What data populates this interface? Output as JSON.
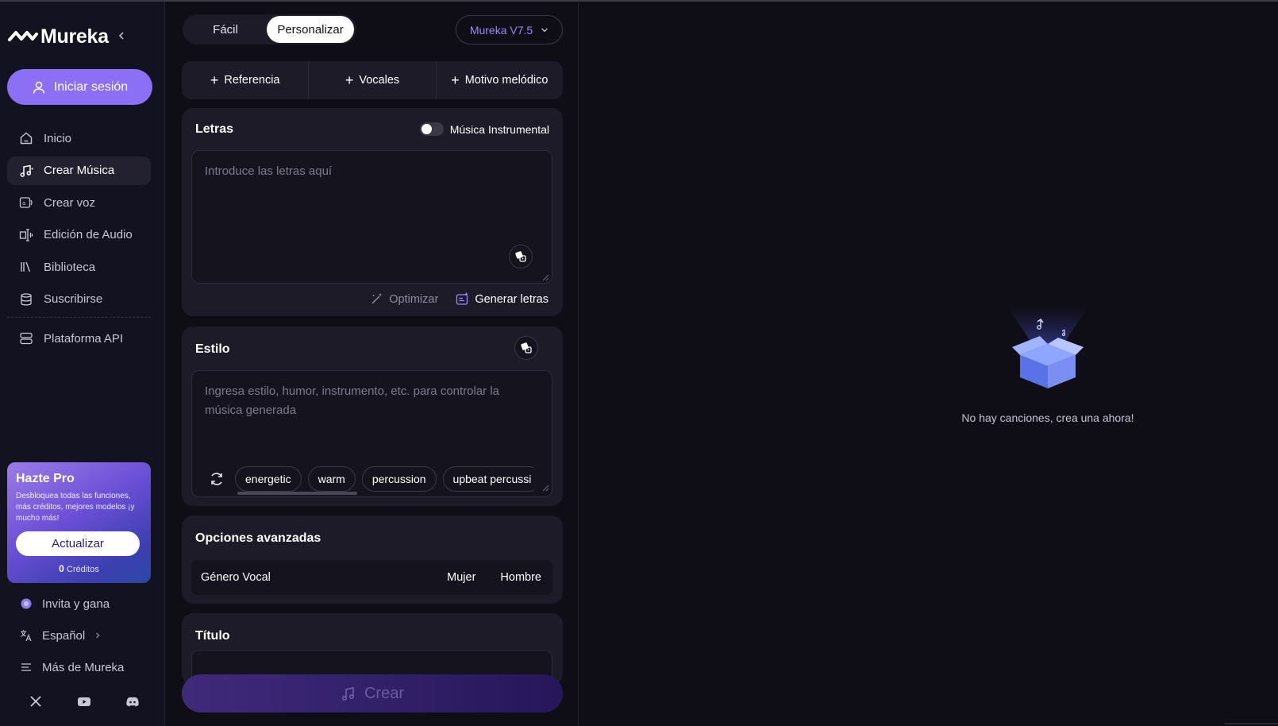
{
  "brand": {
    "name": "Mureka"
  },
  "sidebar": {
    "signin_label": "Iniciar sesión",
    "nav": [
      {
        "label": "Inicio",
        "icon": "home-icon"
      },
      {
        "label": "Crear Música",
        "icon": "music-note-icon",
        "active": true
      },
      {
        "label": "Crear voz",
        "icon": "voice-icon"
      },
      {
        "label": "Edición de Audio",
        "icon": "audio-edit-icon"
      },
      {
        "label": "Biblioteca",
        "icon": "library-icon"
      },
      {
        "label": "Suscribirse",
        "icon": "database-icon"
      },
      {
        "label": "Plataforma API",
        "icon": "server-icon"
      }
    ],
    "pro": {
      "title": "Hazte Pro",
      "description": "Desbloquea todas las funciones, más créditos, mejores modelos ¡y mucho más!",
      "button": "Actualizar",
      "credits_value": "0",
      "credits_label": "Créditos"
    },
    "bottom": [
      {
        "label": "Invita y gana",
        "icon": "gift-icon"
      },
      {
        "label": "Español",
        "icon": "translate-icon"
      },
      {
        "label": "Más de Mureka",
        "icon": "menu-icon"
      }
    ],
    "socials": [
      "x-icon",
      "youtube-icon",
      "discord-icon"
    ]
  },
  "panel": {
    "mode": {
      "easy": "Fácil",
      "custom": "Personalizar",
      "selected": "Personalizar"
    },
    "model": "Mureka V7.5",
    "add_buttons": [
      "Referencia",
      "Vocales",
      "Motivo melódico"
    ],
    "lyrics": {
      "title": "Letras",
      "instrumental_label": "Música Instrumental",
      "instrumental_on": false,
      "placeholder": "Introduce las letras aquí",
      "optimize": "Optimizar",
      "generate": "Generar letras"
    },
    "style": {
      "title": "Estilo",
      "placeholder": "Ingresa estilo, humor, instrumento, etc. para controlar la música generada",
      "chips": [
        "energetic",
        "warm",
        "percussion",
        "upbeat percussi"
      ]
    },
    "advanced": {
      "title": "Opciones avanzadas",
      "vocal_label": "Género Vocal",
      "options": [
        "Mujer",
        "Hombre"
      ]
    },
    "song_title": {
      "title": "Título"
    },
    "create_label": "Crear"
  },
  "empty_state": {
    "text": "No hay canciones, crea una ahora!"
  },
  "colors": {
    "accent": "#8b6ff5",
    "model_text": "#9d86ff",
    "background": "#0f0e17",
    "card": "#1c1b27"
  }
}
